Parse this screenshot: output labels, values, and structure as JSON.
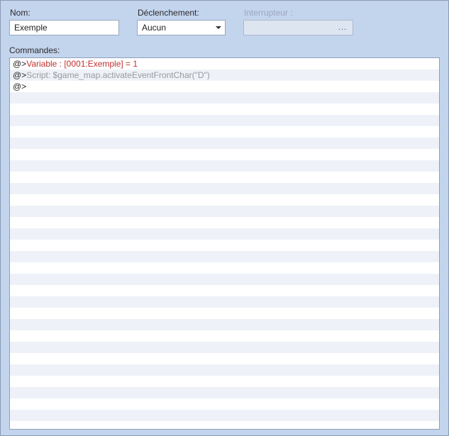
{
  "form": {
    "name_label": "Nom:",
    "name_value": "Exemple",
    "trigger_label": "Déclenchement:",
    "trigger_value": "Aucun",
    "switch_label": "Interrupteur :",
    "switch_value": "",
    "switch_ellipsis": "..."
  },
  "commands_label": "Commandes:",
  "commands": {
    "prefix": "@>",
    "line1": "Variable : [0001:Exemple] = 1",
    "line2": "Script: $game_map.activateEventFrontChar(\"D\")"
  },
  "empty_rows": 30
}
